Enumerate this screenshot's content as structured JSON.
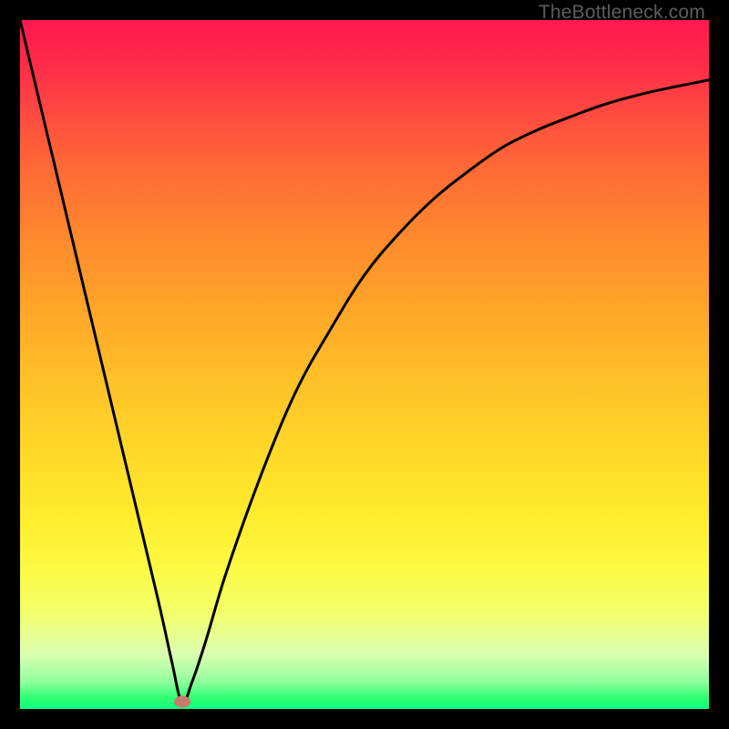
{
  "attribution": "TheBottleneck.com",
  "chart_data": {
    "type": "line",
    "title": "",
    "xlabel": "",
    "ylabel": "",
    "xlim": [
      0,
      100
    ],
    "ylim": [
      0,
      100
    ],
    "grid": false,
    "legend": false,
    "background": "red-to-green vertical gradient (bottleneck heatmap)",
    "series": [
      {
        "name": "bottleneck-curve",
        "x": [
          0,
          5,
          10,
          15,
          20,
          22,
          23.5,
          25,
          27,
          30,
          35,
          40,
          45,
          50,
          55,
          60,
          65,
          70,
          75,
          80,
          85,
          90,
          95,
          100
        ],
        "y": [
          100,
          79,
          58,
          37,
          16,
          7,
          1,
          4,
          10,
          20,
          34,
          46,
          55,
          63,
          69,
          74,
          78,
          81.5,
          84,
          86,
          87.8,
          89.2,
          90.3,
          91.3
        ]
      }
    ],
    "marker": {
      "x": 23.5,
      "y": 1,
      "color": "#c97a6e"
    }
  }
}
